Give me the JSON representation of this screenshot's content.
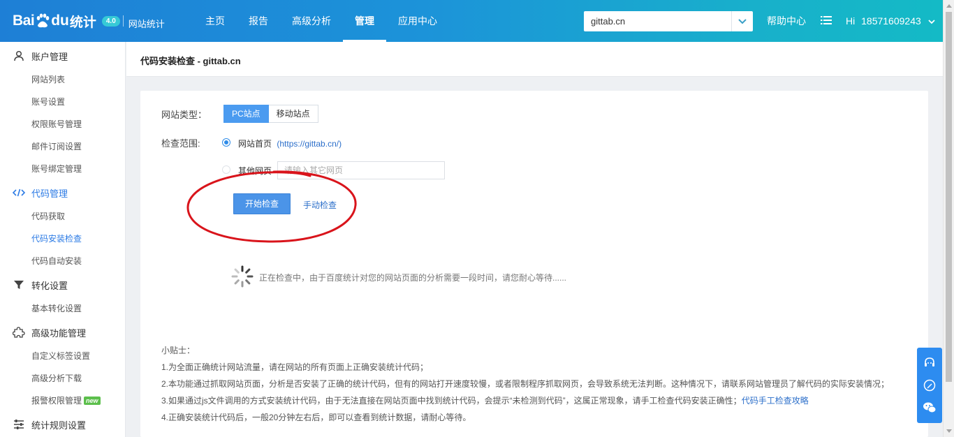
{
  "brand": {
    "logo_bai": "Bai",
    "logo_du": "du",
    "logo_tongji": "统计",
    "version_badge": "4.0",
    "product": "网站统计"
  },
  "nav": [
    {
      "label": "主页"
    },
    {
      "label": "报告"
    },
    {
      "label": "高级分析"
    },
    {
      "label": "管理",
      "active": true
    },
    {
      "label": "应用中心"
    }
  ],
  "site_selector": {
    "value": "gittab.cn"
  },
  "header_right": {
    "help": "帮助中心",
    "greeting": "Hi",
    "username": "18571609243"
  },
  "sidebar": {
    "groups": [
      {
        "icon": "user-icon",
        "label": "账户管理",
        "items": [
          "网站列表",
          "账号设置",
          "权限账号管理",
          "邮件订阅设置",
          "账号绑定管理"
        ]
      },
      {
        "icon": "code-icon",
        "label": "代码管理",
        "active": true,
        "items": [
          "代码获取",
          "代码安装检查",
          "代码自动安装"
        ],
        "active_item": "代码安装检查"
      },
      {
        "icon": "funnel-icon",
        "label": "转化设置",
        "items": [
          "基本转化设置"
        ]
      },
      {
        "icon": "puzzle-icon",
        "label": "高级功能管理",
        "items": [
          "自定义标签设置",
          "高级分析下载",
          "报警权限管理"
        ],
        "new_item": "报警权限管理",
        "new_badge": "new"
      },
      {
        "icon": "sliders-icon",
        "label": "统计规则设置",
        "items": []
      }
    ]
  },
  "page": {
    "title": "代码安装检查 - gittab.cn",
    "site_type_label": "网站类型：",
    "site_type_options": [
      "PC站点",
      "移动站点"
    ],
    "site_type_selected": "PC站点",
    "scope_label": "检查范围:",
    "scope_homepage": "网站首页",
    "scope_homepage_url": "(https://gittab.cn/)",
    "scope_other": "其他网页",
    "other_placeholder": "请输入其它网页",
    "start_button": "开始检查",
    "manual_link": "手动检查",
    "loading_text": "正在检查中，由于百度统计对您的网站页面的分析需要一段时间，请您耐心等待......",
    "tips_title": "小贴士：",
    "tips": [
      "1.为全面正确统计网站流量，请在网站的所有页面上正确安装统计代码；",
      "2.本功能通过抓取网站页面，分析是否安装了正确的统计代码，但有的网站打开速度较慢，或者限制程序抓取网页，会导致系统无法判断。这种情况下，请联系网站管理员了解代码的实际安装情况；",
      "3.如果通过js文件调用的方式安装统计代码，由于无法直接在网站页面中找到统计代码，会提示“未检测到代码”，这属正常现象，请手工检查代码安装正确性；",
      "4.正确安装统计代码后，一般20分钟左右后，即可以查看到统计数据，请耐心等待。"
    ],
    "tips_link": "代码手工检查攻略"
  },
  "colors": {
    "header_start": "#1e7fd6",
    "header_end": "#14bac6",
    "primary": "#4b94e8",
    "link": "#2c6fca",
    "annotation_red": "#d9141b"
  }
}
